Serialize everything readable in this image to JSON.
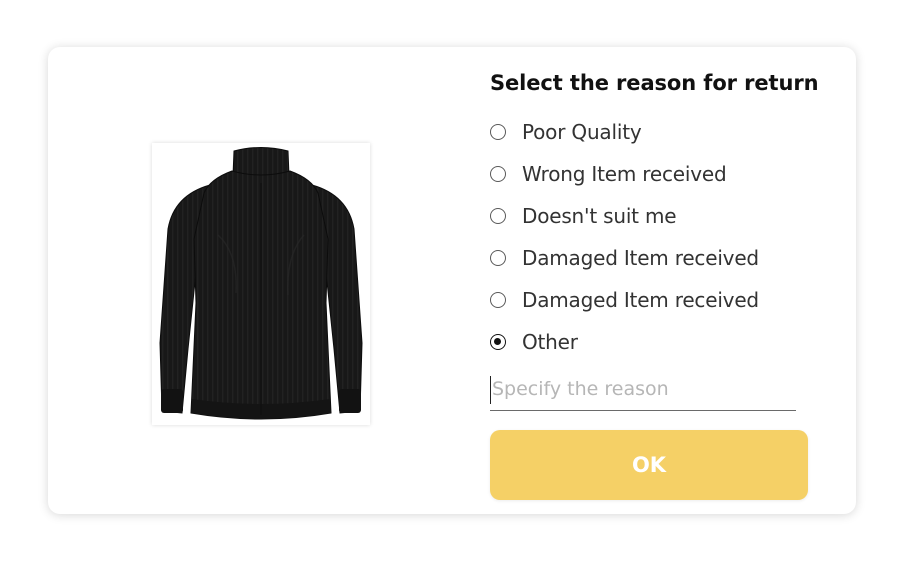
{
  "dialog": {
    "title": "Select the reason for return",
    "product_image": "black-turtleneck-sweater",
    "options": [
      {
        "label": "Poor Quality",
        "checked": false
      },
      {
        "label": "Wrong Item received",
        "checked": false
      },
      {
        "label": "Doesn't suit me",
        "checked": false
      },
      {
        "label": "Damaged Item received",
        "checked": false
      },
      {
        "label": "Damaged Item received",
        "checked": false
      },
      {
        "label": "Other",
        "checked": true
      }
    ],
    "reason_input": {
      "value": "",
      "placeholder": "Specify the reason"
    },
    "ok_label": "OK"
  },
  "colors": {
    "button_bg": "#f5d066",
    "button_text": "#ffffff",
    "title_text": "#111111",
    "option_text": "#333333",
    "placeholder_text": "#b6b6b6",
    "product": "#161616"
  }
}
